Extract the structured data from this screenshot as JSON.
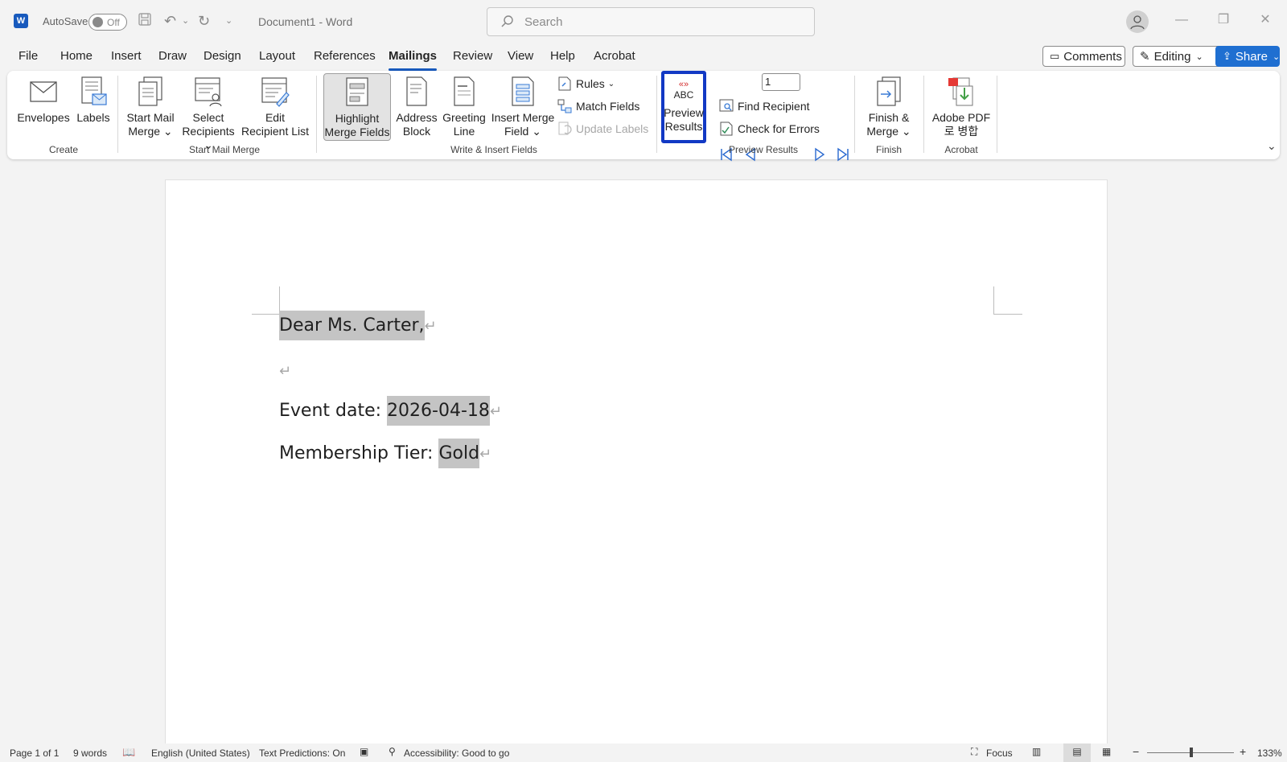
{
  "titlebar": {
    "app_icon_letter": "W",
    "autosave_label": "AutoSave",
    "autosave_state": "Off",
    "document_title": "Document1  -  Word",
    "search_placeholder": "Search"
  },
  "menu_tabs": [
    "File",
    "Home",
    "Insert",
    "Draw",
    "Design",
    "Layout",
    "References",
    "Mailings",
    "Review",
    "View",
    "Help",
    "Acrobat"
  ],
  "active_tab": "Mailings",
  "top_right": {
    "comments_label": "Comments",
    "editing_label": "Editing",
    "share_label": "Share"
  },
  "ribbon": {
    "create": {
      "label": "Create",
      "envelopes": "Envelopes",
      "labels": "Labels"
    },
    "start_mail_merge": {
      "label": "Start Mail Merge",
      "start_line1": "Start Mail",
      "start_line2": "Merge",
      "select_line1": "Select",
      "select_line2": "Recipients",
      "edit_line1": "Edit",
      "edit_line2": "Recipient List"
    },
    "write_insert": {
      "label": "Write & Insert Fields",
      "highlight_line1": "Highlight",
      "highlight_line2": "Merge Fields",
      "address_line1": "Address",
      "address_line2": "Block",
      "greeting_line1": "Greeting",
      "greeting_line2": "Line",
      "insert_line1": "Insert Merge",
      "insert_line2": "Field",
      "rules": "Rules",
      "match_fields": "Match Fields",
      "update_labels": "Update Labels"
    },
    "preview": {
      "label": "Preview Results",
      "icon_text": "ABC",
      "btn_line1": "Preview",
      "btn_line2": "Results",
      "record_number": "1",
      "find_recipient": "Find Recipient",
      "check_errors": "Check for Errors"
    },
    "finish": {
      "label": "Finish",
      "btn_line1": "Finish &",
      "btn_line2": "Merge"
    },
    "acrobat": {
      "label": "Acrobat",
      "btn_line1": "Adobe PDF",
      "btn_line2": "로 병합"
    }
  },
  "document": {
    "salutation": "Dear Ms. Carter,",
    "event_label": "Event date: ",
    "event_date": "2026-04-18",
    "tier_label": "Membership Tier: ",
    "tier_value": "Gold",
    "paragraph_mark": "↵"
  },
  "statusbar": {
    "page": "Page 1 of 1",
    "words": "9 words",
    "language": "English (United States)",
    "text_predictions": "Text Predictions: On",
    "accessibility": "Accessibility: Good to go",
    "focus": "Focus",
    "zoom": "133%"
  },
  "colors": {
    "accent": "#185abd",
    "highlight_border": "#1239c4",
    "field_shading": "#c4c4c4"
  }
}
